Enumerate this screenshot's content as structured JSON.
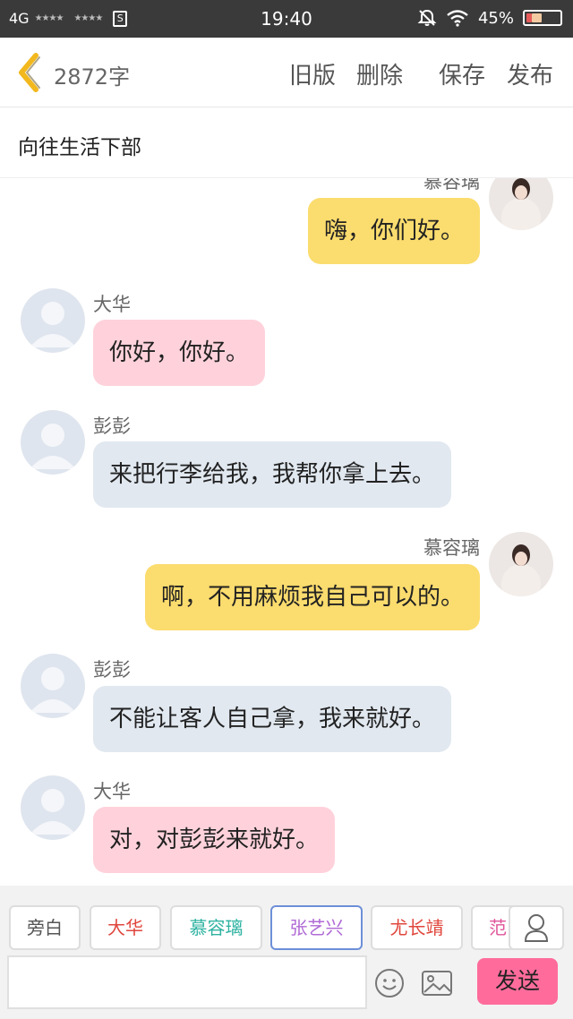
{
  "status_bar": {
    "network": "4G",
    "stars1": "★★★★",
    "stars2": "★★★★",
    "sim": "S",
    "time": "19:40",
    "battery": "45%",
    "battery_level_percent": 45
  },
  "toolbar": {
    "word_count": "2872字",
    "old_version": "旧版",
    "delete": "删除",
    "save": "保存",
    "publish": "发布"
  },
  "title": "向往生活下部",
  "messages": [
    {
      "side": "right",
      "name": "慕容璃",
      "text": "嗨，你们好。",
      "color": "yellow",
      "avatar": "portrait-avatar"
    },
    {
      "side": "left",
      "name": "大华",
      "text": "你好，你好。",
      "color": "pink",
      "avatar": "default-avatar"
    },
    {
      "side": "left",
      "name": "彭彭",
      "text": "来把行李给我，我帮你拿上去。",
      "color": "blue",
      "avatar": "default-avatar"
    },
    {
      "side": "right",
      "name": "慕容璃",
      "text": "啊，不用麻烦我自己可以的。",
      "color": "yellow",
      "avatar": "portrait-avatar"
    },
    {
      "side": "left",
      "name": "彭彭",
      "text": "不能让客人自己拿，我来就好。",
      "color": "blue",
      "avatar": "default-avatar"
    },
    {
      "side": "left",
      "name": "大华",
      "text": "对，对彭彭来就好。",
      "color": "pink",
      "avatar": "default-avatar"
    }
  ],
  "characters": [
    {
      "label": "旁白",
      "color": "#555555",
      "selected": false
    },
    {
      "label": "大华",
      "color": "#e0463c",
      "selected": false
    },
    {
      "label": "慕容璃",
      "color": "#2fb3a2",
      "selected": false
    },
    {
      "label": "张艺兴",
      "color": "#b06ad6",
      "selected": true
    },
    {
      "label": "尤长靖",
      "color": "#e0463c",
      "selected": false
    },
    {
      "label": "范",
      "color": "#e0559a",
      "selected": false
    }
  ],
  "input": {
    "value": "",
    "placeholder": ""
  },
  "send_label": "发送",
  "colors": {
    "yellow_bubble": "#fbdc6e",
    "pink_bubble": "#ffd2db",
    "blue_bubble": "#e1e8f0",
    "send_button": "#ff6c9c",
    "back_arrow": "#f2b81d",
    "selected_chip_border": "#6d8fd8"
  },
  "icons": [
    "back-arrow-icon",
    "mute-icon",
    "wifi-icon",
    "battery-icon",
    "person-icon",
    "emoji-icon",
    "image-icon"
  ]
}
